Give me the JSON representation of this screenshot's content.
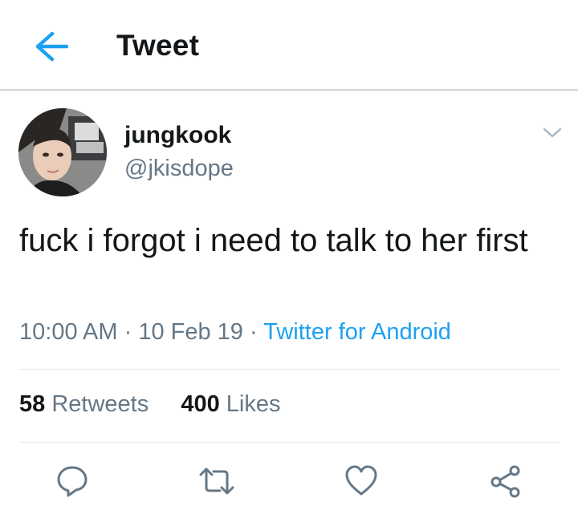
{
  "header": {
    "title": "Tweet"
  },
  "tweet": {
    "author": {
      "name": "jungkook",
      "handle": "@jkisdope"
    },
    "text": "fuck i forgot i need to talk to her first",
    "meta": {
      "time": "10:00 AM",
      "date": "10 Feb 19",
      "separator": "·",
      "source": "Twitter for Android"
    },
    "stats": {
      "retweets_count": "58",
      "retweets_label": "Retweets",
      "likes_count": "400",
      "likes_label": "Likes"
    }
  },
  "icons": {
    "back": "arrow-left-icon",
    "caret": "chevron-down-icon",
    "reply": "reply-icon",
    "retweet": "retweet-icon",
    "like": "heart-icon",
    "share": "share-icon"
  },
  "colors": {
    "accent": "#1da1f2",
    "secondary_text": "#657786",
    "text": "#14171a"
  }
}
